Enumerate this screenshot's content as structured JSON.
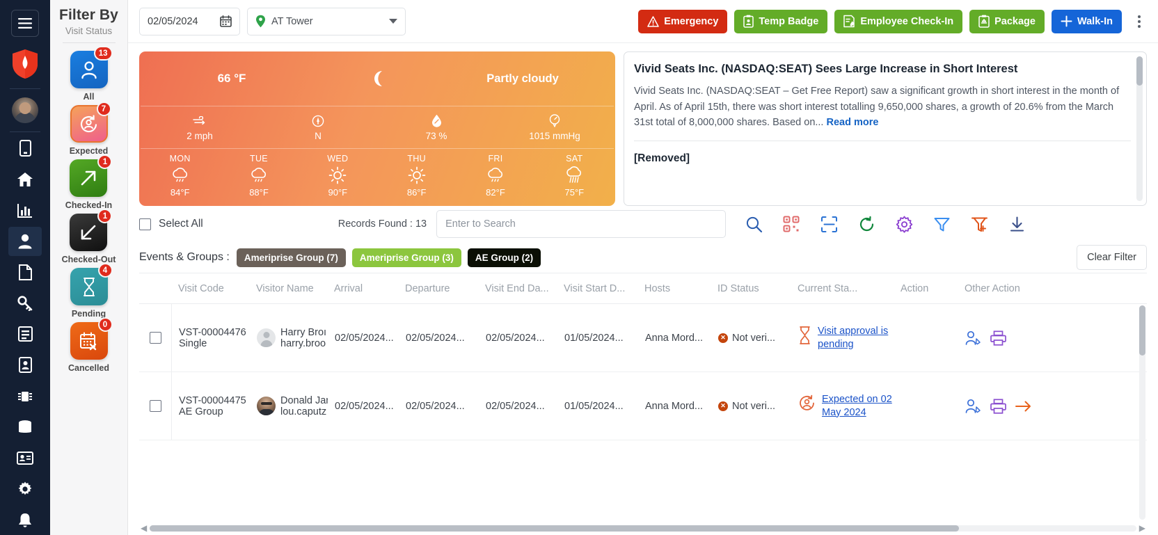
{
  "rail": {
    "menu_icon": "hamburger-menu-icon",
    "logo_icon": "shield-logo-icon",
    "avatar": "user-avatar",
    "items": [
      {
        "name": "mobile",
        "icon": "mobile-icon"
      },
      {
        "name": "home",
        "icon": "home-icon"
      },
      {
        "name": "reports",
        "icon": "bar-chart-icon"
      },
      {
        "name": "visitors",
        "icon": "person-icon",
        "active": true
      },
      {
        "name": "documents",
        "icon": "file-icon"
      },
      {
        "name": "access-keys",
        "icon": "key-icon"
      },
      {
        "name": "logs",
        "icon": "list-icon"
      },
      {
        "name": "badges",
        "icon": "id-badge-icon"
      },
      {
        "name": "devices",
        "icon": "chip-icon"
      },
      {
        "name": "database",
        "icon": "database-icon"
      },
      {
        "name": "contacts",
        "icon": "contact-card-icon"
      },
      {
        "name": "settings",
        "icon": "gear-icon"
      },
      {
        "name": "notifications",
        "icon": "bell-icon"
      }
    ]
  },
  "filter": {
    "title": "Filter By",
    "subtitle": "Visit Status",
    "items": [
      {
        "label": "All",
        "count": "13",
        "icon": "person-icon",
        "color": "#1a7ee0"
      },
      {
        "label": "Expected",
        "count": "7",
        "icon": "person-clock-icon",
        "color": "#ef5f8c"
      },
      {
        "label": "Checked-In",
        "count": "1",
        "icon": "arrow-up-right-icon",
        "color": "#54a825"
      },
      {
        "label": "Checked-Out",
        "count": "1",
        "icon": "arrow-down-left-icon",
        "color": "#1a1a1a"
      },
      {
        "label": "Pending",
        "count": "4",
        "icon": "hourglass-icon",
        "color": "#36a3ad"
      },
      {
        "label": "Cancelled",
        "count": "0",
        "icon": "calendar-x-icon",
        "color": "#ef6b18"
      }
    ]
  },
  "topbar": {
    "date_value": "02/05/2024",
    "calendar_icon": "calendar-icon",
    "location_value": "AT Tower",
    "location_icon": "map-pin-icon",
    "buttons": [
      {
        "label": "Emergency",
        "icon": "warning-triangle-icon",
        "style": "emergency"
      },
      {
        "label": "Temp Badge",
        "icon": "temp-badge-icon",
        "style": "green"
      },
      {
        "label": "Employee Check-In",
        "icon": "employee-checkin-icon",
        "style": "green"
      },
      {
        "label": "Package",
        "icon": "package-clipboard-icon",
        "style": "green"
      },
      {
        "label": "Walk-In",
        "icon": "plus-icon",
        "style": "blue"
      }
    ],
    "more_icon": "kebab-menu-icon"
  },
  "weather": {
    "temperature": "66 °F",
    "condition": "Partly cloudy",
    "condition_icon": "partly-cloudy-icon",
    "metrics": [
      {
        "name": "wind",
        "icon": "wind-icon",
        "value": "2 mph"
      },
      {
        "name": "wind-direction",
        "icon": "compass-icon",
        "value": "N"
      },
      {
        "name": "humidity",
        "icon": "humidity-drop-icon",
        "value": "73 %"
      },
      {
        "name": "pressure",
        "icon": "pressure-gauge-icon",
        "value": "1015 mmHg"
      }
    ],
    "forecast": [
      {
        "day": "MON",
        "icon": "rain-cloud-icon",
        "temp": "84°F"
      },
      {
        "day": "TUE",
        "icon": "rain-cloud-icon",
        "temp": "88°F"
      },
      {
        "day": "WED",
        "icon": "sun-icon",
        "temp": "90°F"
      },
      {
        "day": "THU",
        "icon": "sun-icon",
        "temp": "86°F"
      },
      {
        "day": "FRI",
        "icon": "rain-cloud-icon",
        "temp": "82°F"
      },
      {
        "day": "SAT",
        "icon": "heavy-rain-icon",
        "temp": "75°F"
      }
    ]
  },
  "news": {
    "headline": "Vivid Seats Inc. (NASDAQ:SEAT) Sees Large Increase in Short Interest",
    "body": "Vivid Seats Inc. (NASDAQ:SEAT – Get Free Report) saw a significant growth in short interest in the month of April. As of April 15th, there was short interest totalling 9,650,000 shares, a growth of 20.6% from the March 31st total of 8,000,000 shares. Based on...",
    "read_more": "Read more",
    "second_headline": "[Removed]"
  },
  "toolbar": {
    "select_all": "Select All",
    "records_found": "Records Found : 13",
    "search_placeholder": "Enter to Search",
    "search_value": "",
    "icons": [
      {
        "name": "search-icon",
        "color": "#2a5db0"
      },
      {
        "name": "qr-code-icon",
        "color": "#e06a6a"
      },
      {
        "name": "scan-barcode-icon",
        "color": "#2a72d4"
      },
      {
        "name": "refresh-icon",
        "color": "#11873c"
      },
      {
        "name": "gear-icon",
        "color": "#8b3fd0"
      },
      {
        "name": "filter-icon",
        "color": "#3a8ef0"
      },
      {
        "name": "filter-add-icon",
        "color": "#e0541a"
      },
      {
        "name": "download-icon",
        "color": "#3a4f8a"
      }
    ]
  },
  "events": {
    "label": "Events & Groups :",
    "chips": [
      {
        "label": "Ameriprise Group (7)",
        "style": "a"
      },
      {
        "label": "Ameriprise Group (3)",
        "style": "b"
      },
      {
        "label": "AE Group (2)",
        "style": "c"
      }
    ],
    "clear_filter": "Clear Filter"
  },
  "table": {
    "columns": [
      "Visit Code",
      "Visitor Name",
      "Arrival",
      "Departure",
      "Visit End Da...",
      "Visit Start D...",
      "Hosts",
      "ID Status",
      "Current Sta...",
      "Action",
      "Other Action"
    ],
    "rows": [
      {
        "visit_code": "VST-00004476 Single",
        "visitor_name": "Harry Broı",
        "visitor_email": "harry.broo",
        "avatar": "generic-avatar",
        "arrival": "02/05/2024...",
        "departure": "02/05/2024...",
        "visit_end": "02/05/2024...",
        "visit_start": "01/05/2024...",
        "host": "Anna Mord...",
        "id_status": "Not veri...",
        "status_icon": "hourglass-icon",
        "current_status": "Visit approval is pending",
        "actions": [
          "visitor-edit-icon",
          "print-icon"
        ]
      },
      {
        "visit_code": "VST-00004475 AE Group",
        "visitor_name": "Donald Jan",
        "visitor_email": "lou.caputz",
        "avatar": "photo-avatar",
        "arrival": "02/05/2024...",
        "departure": "02/05/2024...",
        "visit_end": "02/05/2024...",
        "visit_start": "01/05/2024...",
        "host": "Anna Mord...",
        "id_status": "Not veri...",
        "status_icon": "person-clock-icon",
        "current_status": "Expected on 02 May 2024",
        "actions": [
          "visitor-edit-icon",
          "print-icon",
          "arrow-right-icon"
        ]
      }
    ]
  }
}
